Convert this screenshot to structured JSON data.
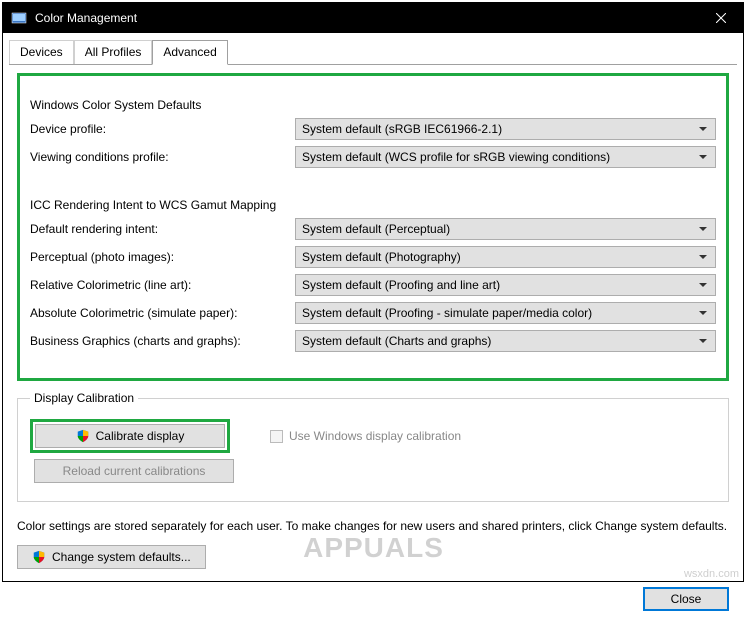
{
  "window": {
    "title": "Color Management"
  },
  "tabs": {
    "devices": "Devices",
    "allProfiles": "All Profiles",
    "advanced": "Advanced"
  },
  "group1": {
    "legend": "Windows Color System Defaults",
    "deviceProfileLabel": "Device profile:",
    "deviceProfileValue": "System default (sRGB IEC61966-2.1)",
    "viewingLabel": "Viewing conditions profile:",
    "viewingValue": "System default (WCS profile for sRGB viewing conditions)"
  },
  "group2": {
    "legend": "ICC Rendering Intent to WCS Gamut Mapping",
    "defaultIntentLabel": "Default rendering intent:",
    "defaultIntentValue": "System default (Perceptual)",
    "perceptualLabel": "Perceptual (photo images):",
    "perceptualValue": "System default (Photography)",
    "relativeLabel": "Relative Colorimetric (line art):",
    "relativeValue": "System default (Proofing and line art)",
    "absoluteLabel": "Absolute Colorimetric (simulate paper):",
    "absoluteValue": "System default (Proofing - simulate paper/media color)",
    "businessLabel": "Business Graphics (charts and graphs):",
    "businessValue": "System default (Charts and graphs)"
  },
  "calibration": {
    "legend": "Display Calibration",
    "calibrateBtn": "Calibrate display",
    "useWindowsCb": "Use Windows display calibration",
    "reloadBtn": "Reload current calibrations"
  },
  "footer": {
    "text": "Color settings are stored separately for each user. To make changes for new users and shared printers, click Change system defaults.",
    "changeDefaultsBtn": "Change system defaults...",
    "closeBtn": "Close"
  },
  "watermark": "APPUALS",
  "watermark2": "wsxdn.com"
}
